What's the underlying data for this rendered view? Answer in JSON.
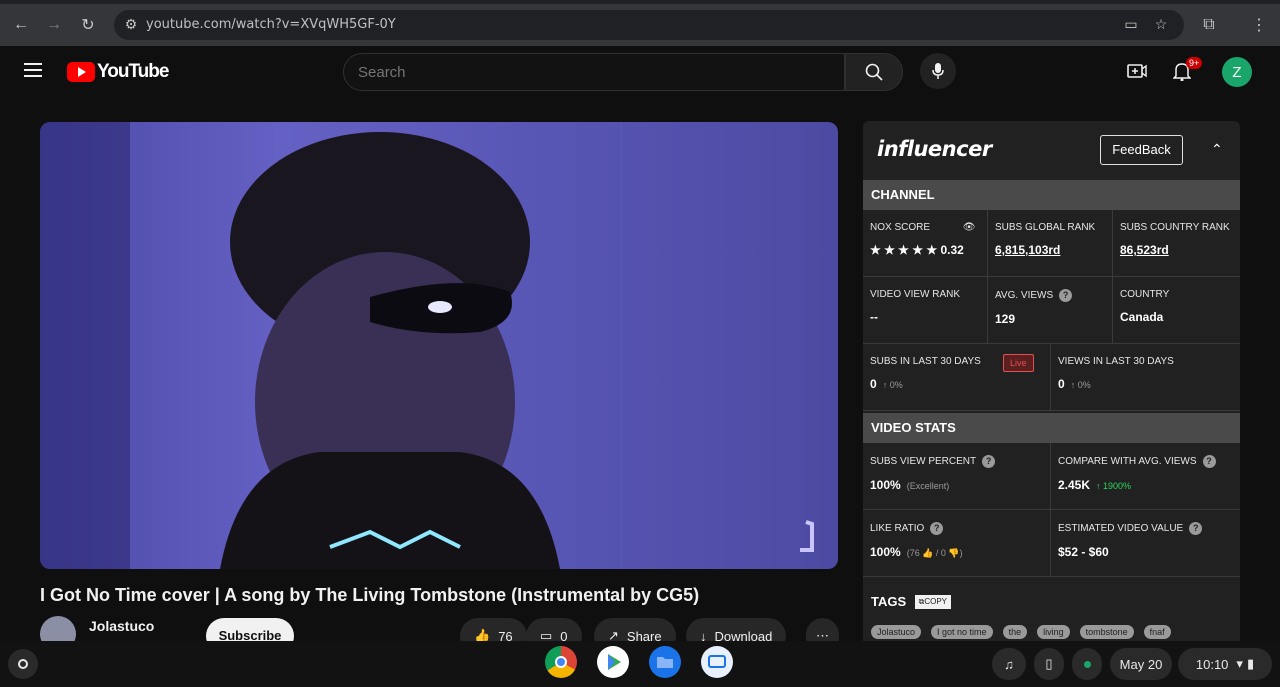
{
  "browser": {
    "url": "youtube.com/watch?v=XVqWH5GF-0Y"
  },
  "header": {
    "logo_text": "YouTube",
    "search_placeholder": "Search",
    "notification_count": "9+",
    "avatar_letter": "Z"
  },
  "video": {
    "title": "I Got No Time cover | A song by The Living Tombstone (Instrumental by CG5)",
    "channel_name": "Jolastuco",
    "subscribe_label": "Subscribe",
    "likes": "76",
    "comments": "0",
    "share_label": "Share",
    "download_label": "Download"
  },
  "influencer": {
    "logo_text": "influencer",
    "feedback_label": "FeedBack",
    "channel_section": "CHANNEL",
    "nox_score_label": "NOX SCORE",
    "nox_score_value": "0.32",
    "nox_stars": 5,
    "subs_global_rank_label": "SUBS GLOBAL RANK",
    "subs_global_rank_value": "6,815,103rd",
    "subs_country_rank_label": "SUBS COUNTRY RANK",
    "subs_country_rank_value": "86,523rd",
    "video_view_rank_label": "VIDEO VIEW RANK",
    "video_view_rank_value": "--",
    "avg_views_label": "AVG. VIEWS",
    "avg_views_value": "129",
    "country_label": "COUNTRY",
    "country_value": "Canada",
    "subs_30_label": "SUBS IN LAST 30 DAYS",
    "subs_30_value": "0",
    "subs_30_change": "↑ 0%",
    "live_tag": "Live",
    "views_30_label": "VIEWS IN LAST 30 DAYS",
    "views_30_value": "0",
    "views_30_change": "↑ 0%",
    "video_stats_section": "VIDEO STATS",
    "subs_view_percent_label": "SUBS VIEW PERCENT",
    "subs_view_percent_value": "100%",
    "subs_view_percent_note": "(Excellent)",
    "compare_avg_label": "COMPARE WITH AVG. VIEWS",
    "compare_avg_value": "2.45K",
    "compare_avg_change": "↑ 1900%",
    "like_ratio_label": "LIKE RATIO",
    "like_ratio_value": "100%",
    "like_ratio_note": "(76 👍 / 0 👎)",
    "est_value_label": "ESTIMATED VIDEO VALUE",
    "est_value_value": "$52 - $60",
    "tags_label": "TAGS",
    "copy_label": "COPY",
    "tags": [
      "Jolastuco",
      "I got no time",
      "the",
      "living",
      "tombstone",
      "fnaf"
    ]
  },
  "shelf": {
    "date": "May 20",
    "time": "10:10"
  },
  "colors": {
    "youtube_red": "#ff0000",
    "panel_bg": "#212121",
    "positive_green": "#2dd55b",
    "avatar_green": "#1aa66a"
  }
}
